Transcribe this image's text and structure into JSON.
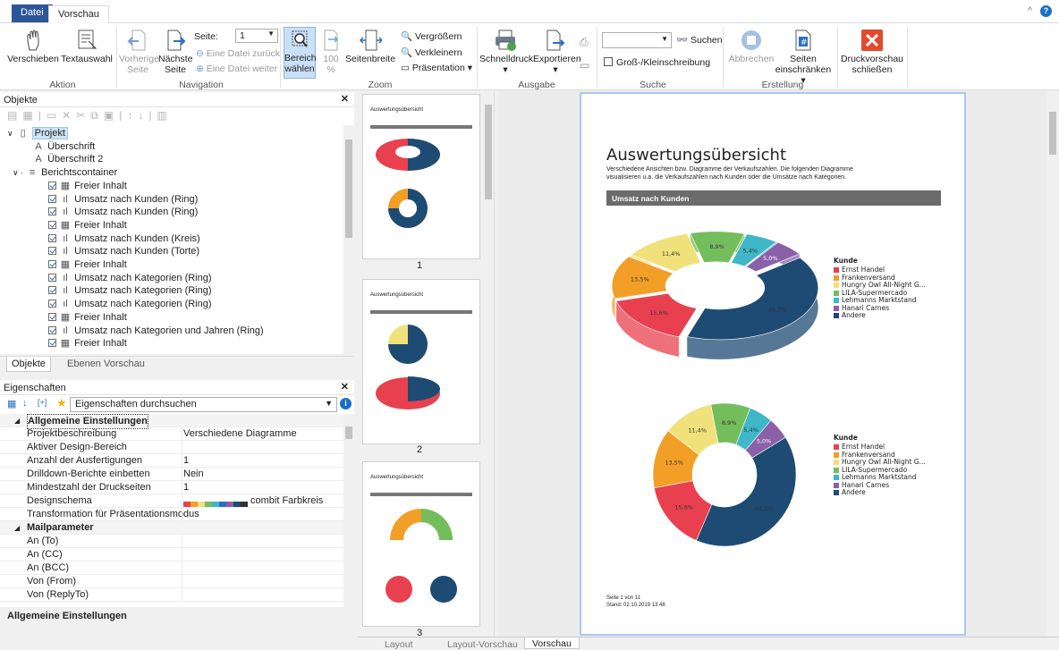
{
  "tabs": {
    "file": "Datei",
    "preview": "Vorschau"
  },
  "ribbon": {
    "move": "Verschieben",
    "textselect": "Textauswahl",
    "group_action": "Aktion",
    "prev_page": "Vorherige Seite",
    "next_page": "Nächste Seite",
    "page_label": "Seite:",
    "page_value": "1",
    "prev_file": "Eine Datei zurück",
    "next_file": "Eine Datei weiter",
    "group_nav": "Navigation",
    "select_area": "Bereich wählen",
    "zoom100": "100 %",
    "page_width": "Seitenbreite",
    "enlarge": "Vergrößern",
    "shrink": "Verkleinern",
    "presentation": "Präsentation",
    "group_zoom": "Zoom",
    "quickprint": "Schnelldruck",
    "export": "Exportieren",
    "group_output": "Ausgabe",
    "search": "Suchen",
    "case": "Groß-/Kleinschreibung",
    "group_search": "Suche",
    "cancel": "Abbrechen",
    "limit_pages": "Seiten einschränken",
    "group_create": "Erstellung",
    "close_preview": "Druckvorschau schließen"
  },
  "objects": {
    "title": "Objekte",
    "tree": [
      {
        "label": "Projekt",
        "level": 0,
        "icon": "doc"
      },
      {
        "label": "Überschrift",
        "level": 1,
        "icon": "text"
      },
      {
        "label": "Überschrift 2",
        "level": 1,
        "icon": "text"
      },
      {
        "label": "Berichtscontainer",
        "level": 1,
        "icon": "container"
      },
      {
        "label": "Freier Inhalt",
        "level": 2,
        "icon": "table"
      },
      {
        "label": "Umsatz nach Kunden (Ring)",
        "level": 2,
        "icon": "chart"
      },
      {
        "label": "Umsatz nach Kunden (Ring)",
        "level": 2,
        "icon": "chart"
      },
      {
        "label": "Freier Inhalt",
        "level": 2,
        "icon": "table"
      },
      {
        "label": "Umsatz nach Kunden (Kreis)",
        "level": 2,
        "icon": "chart"
      },
      {
        "label": "Umsatz nach Kunden (Torte)",
        "level": 2,
        "icon": "chart"
      },
      {
        "label": "Freier Inhalt",
        "level": 2,
        "icon": "table"
      },
      {
        "label": "Umsatz nach Kategorien (Ring)",
        "level": 2,
        "icon": "chart"
      },
      {
        "label": "Umsatz nach Kategorien (Ring)",
        "level": 2,
        "icon": "chart"
      },
      {
        "label": "Umsatz nach Kategorien (Ring)",
        "level": 2,
        "icon": "chart"
      },
      {
        "label": "Freier Inhalt",
        "level": 2,
        "icon": "table"
      },
      {
        "label": "Umsatz nach Kategorien und Jahren (Ring)",
        "level": 2,
        "icon": "chart"
      },
      {
        "label": "Freier Inhalt",
        "level": 2,
        "icon": "table"
      }
    ],
    "tabs": [
      "Objekte",
      "Ebenen",
      "Vorschau"
    ]
  },
  "properties": {
    "title": "Eigenschaften",
    "search_placeholder": "Eigenschaften durchsuchen",
    "rows": [
      {
        "key": "Allgemeine Einstellungen",
        "value": "",
        "section": true
      },
      {
        "key": "Projektbeschreibung",
        "value": "Verschiedene Diagramme"
      },
      {
        "key": "Aktiver Design-Bereich",
        "value": ""
      },
      {
        "key": "Anzahl der Ausfertigungen",
        "value": "1"
      },
      {
        "key": "Drilldown-Berichte einbetten",
        "value": "Nein"
      },
      {
        "key": "Mindestzahl der Druckseiten",
        "value": "1"
      },
      {
        "key": "Designschema",
        "value": "combit Farbkreis"
      },
      {
        "key": "Transformation für Präsentationsmodus",
        "value": ""
      },
      {
        "key": "Mailparameter",
        "value": "",
        "section": true
      },
      {
        "key": "An (To)",
        "value": ""
      },
      {
        "key": "An (CC)",
        "value": ""
      },
      {
        "key": "An (BCC)",
        "value": ""
      },
      {
        "key": "Von (From)",
        "value": ""
      },
      {
        "key": "Von (ReplyTo)",
        "value": ""
      }
    ],
    "footer": "Allgemeine Einstellungen"
  },
  "thumbs": [
    "1",
    "2",
    "3"
  ],
  "preview": {
    "title": "Auswertungsübersicht",
    "subtitle1": "Verschiedene Ansichten bzw. Diagramme der Verkaufszahlen. Die folgenden Diagramme",
    "subtitle2": "visualisieren u.a. die Verkaufszahlen nach Kunden oder die Umsätze nach Kategorien.",
    "section": "Umsatz nach Kunden",
    "legend_title": "Kunde",
    "footer1": "Seite 1 von 11",
    "footer2": "Stand: 02.10.2019 13:48"
  },
  "chart_data": [
    {
      "type": "pie",
      "title": "",
      "legend_title": "Kunde",
      "categories": [
        "Ernst Handel",
        "Frankenversand",
        "Hungry Owl All-Night G...",
        "LILA-Supermercado",
        "Lehmanns Marktstand",
        "Hanari Carnes",
        "Andere"
      ],
      "values": [
        15.6,
        13.5,
        11.4,
        8.9,
        5.4,
        5.0,
        40.3
      ],
      "labels": [
        "15,6%",
        "13,5%",
        "11,4%",
        "8,9%",
        "5,4%",
        "5,0%",
        "40,3%"
      ],
      "colors": [
        "#e8404f",
        "#f29f27",
        "#f0e17b",
        "#74bd5d",
        "#3fb7c8",
        "#8a60a8",
        "#1d4b73"
      ]
    },
    {
      "type": "pie",
      "title": "",
      "legend_title": "Kunde",
      "categories": [
        "Ernst Handel",
        "Frankenversand",
        "Hungry Owl All-Night G...",
        "LILA-Supermercado",
        "Lehmanns Marktstand",
        "Hanari Carnes",
        "Andere"
      ],
      "values": [
        15.6,
        13.5,
        11.4,
        8.9,
        5.4,
        5.0,
        40.2
      ],
      "labels": [
        "15,6%",
        "13,5%",
        "11,4%",
        "8,9%",
        "5,4%",
        "5,0%",
        "40,2%"
      ],
      "colors": [
        "#e8404f",
        "#f29f27",
        "#f0e17b",
        "#74bd5d",
        "#3fb7c8",
        "#8a60a8",
        "#1d4b73"
      ]
    }
  ],
  "bottom_tabs": [
    "Layout",
    "Layout-Vorschau",
    "Vorschau"
  ]
}
